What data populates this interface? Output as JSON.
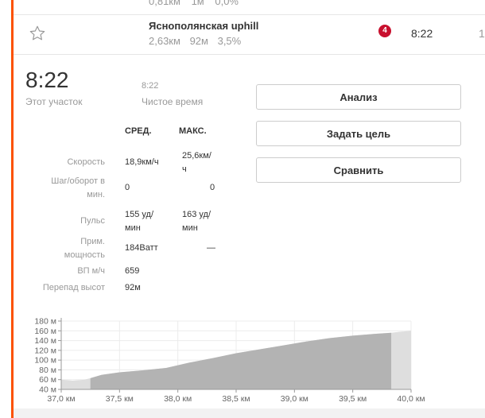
{
  "previous_row": {
    "distance": "0,81км",
    "elevation": "1м",
    "grade": "0,0%"
  },
  "segment": {
    "name": "Яснополянская uphill",
    "distance": "2,63км",
    "elevation": "92м",
    "grade": "3,5%",
    "badge": "4",
    "time": "8:22",
    "rank": "1"
  },
  "summary": {
    "elapsed_time": "8:22",
    "elapsed_label": "Этот участок",
    "moving_time": "8:22",
    "moving_label": "Чистое время"
  },
  "stats": {
    "headers": {
      "avg": "СРЕД.",
      "max": "МАКС."
    },
    "rows": [
      {
        "label": [
          "Скорость"
        ],
        "avg": [
          "18,9км/ч"
        ],
        "max": [
          "25,6км/",
          "ч"
        ]
      },
      {
        "label": [
          "Шаг/оборот в",
          "мин."
        ],
        "avg": [
          "0"
        ],
        "max": [
          "0"
        ]
      },
      {
        "label": [
          "Пульс"
        ],
        "avg": [
          "155 уд/",
          "мин"
        ],
        "max": [
          "163 уд/",
          "мин"
        ]
      },
      {
        "label": [
          "Прим.",
          "мощность"
        ],
        "avg": [
          "184Ватт"
        ],
        "max": [
          "—"
        ]
      },
      {
        "label": [
          "ВП м/ч"
        ],
        "avg": [
          "659"
        ],
        "max": []
      },
      {
        "label": [
          "Перепад высот"
        ],
        "avg": [
          "92м"
        ],
        "max": []
      }
    ]
  },
  "buttons": {
    "analysis": "Анализ",
    "set_goal": "Задать цель",
    "compare": "Сравнить"
  },
  "colors": {
    "accent": "#fc5200",
    "badge": "#c8102e",
    "elevation_fill": "#b3b3b3",
    "elevation_context": "#dedede"
  },
  "chart_data": {
    "type": "area",
    "title": "",
    "xlabel": "",
    "ylabel": "",
    "xlim": [
      37.0,
      40.0
    ],
    "ylim": [
      40,
      180
    ],
    "x_ticks": [
      "37,0 км",
      "37,5 км",
      "38,0 км",
      "38,5 км",
      "39,0 км",
      "39,5 км",
      "40,0 км"
    ],
    "y_ticks": [
      "40 м",
      "60 м",
      "80 м",
      "100 м",
      "120 м",
      "140 м",
      "160 м",
      "180 м"
    ],
    "grid": true,
    "segment_range": [
      37.25,
      39.83
    ],
    "x": [
      37.0,
      37.1,
      37.2,
      37.25,
      37.35,
      37.5,
      37.7,
      37.9,
      38.1,
      38.3,
      38.5,
      38.7,
      38.9,
      39.1,
      39.3,
      39.5,
      39.7,
      39.83,
      39.9,
      40.0
    ],
    "y": [
      60,
      58,
      60,
      63,
      70,
      75,
      79,
      84,
      95,
      104,
      114,
      122,
      130,
      138,
      145,
      150,
      154,
      156,
      158,
      160
    ]
  }
}
